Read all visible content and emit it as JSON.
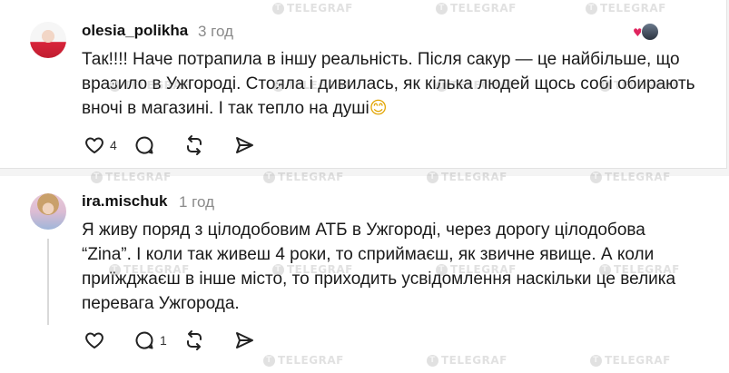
{
  "comments": [
    {
      "username": "olesia_polikha",
      "time": "3 год",
      "text": "Так!!!! Наче потрапила в іншу реальність. Після сакур — це найбільше, що\nвразило в Ужгороді. Стояла і дивилась, як кілька людей щось собі обирають\nвночі в магазині. І так тепло на душі",
      "emoji": "😊",
      "likes": "4",
      "replies": "",
      "liked_by_author": "♥"
    },
    {
      "username": "ira.mischuk",
      "time": "1 год",
      "text": "Я живу поряд з цілодобовим АТБ в Ужгороді, через дорогу цілодобова\n“Zina”. І коли так живеш 4 роки, то сприймаєш, як звичне явище. А коли\nприїжджаєш в інше місто, то приходить усвідомлення наскільки це велика\nперевага Ужгорода.",
      "likes": "",
      "replies": "1"
    }
  ],
  "watermark": "TELEGRAF",
  "icons": [
    "heart-icon",
    "comment-icon",
    "repost-icon",
    "share-icon"
  ]
}
